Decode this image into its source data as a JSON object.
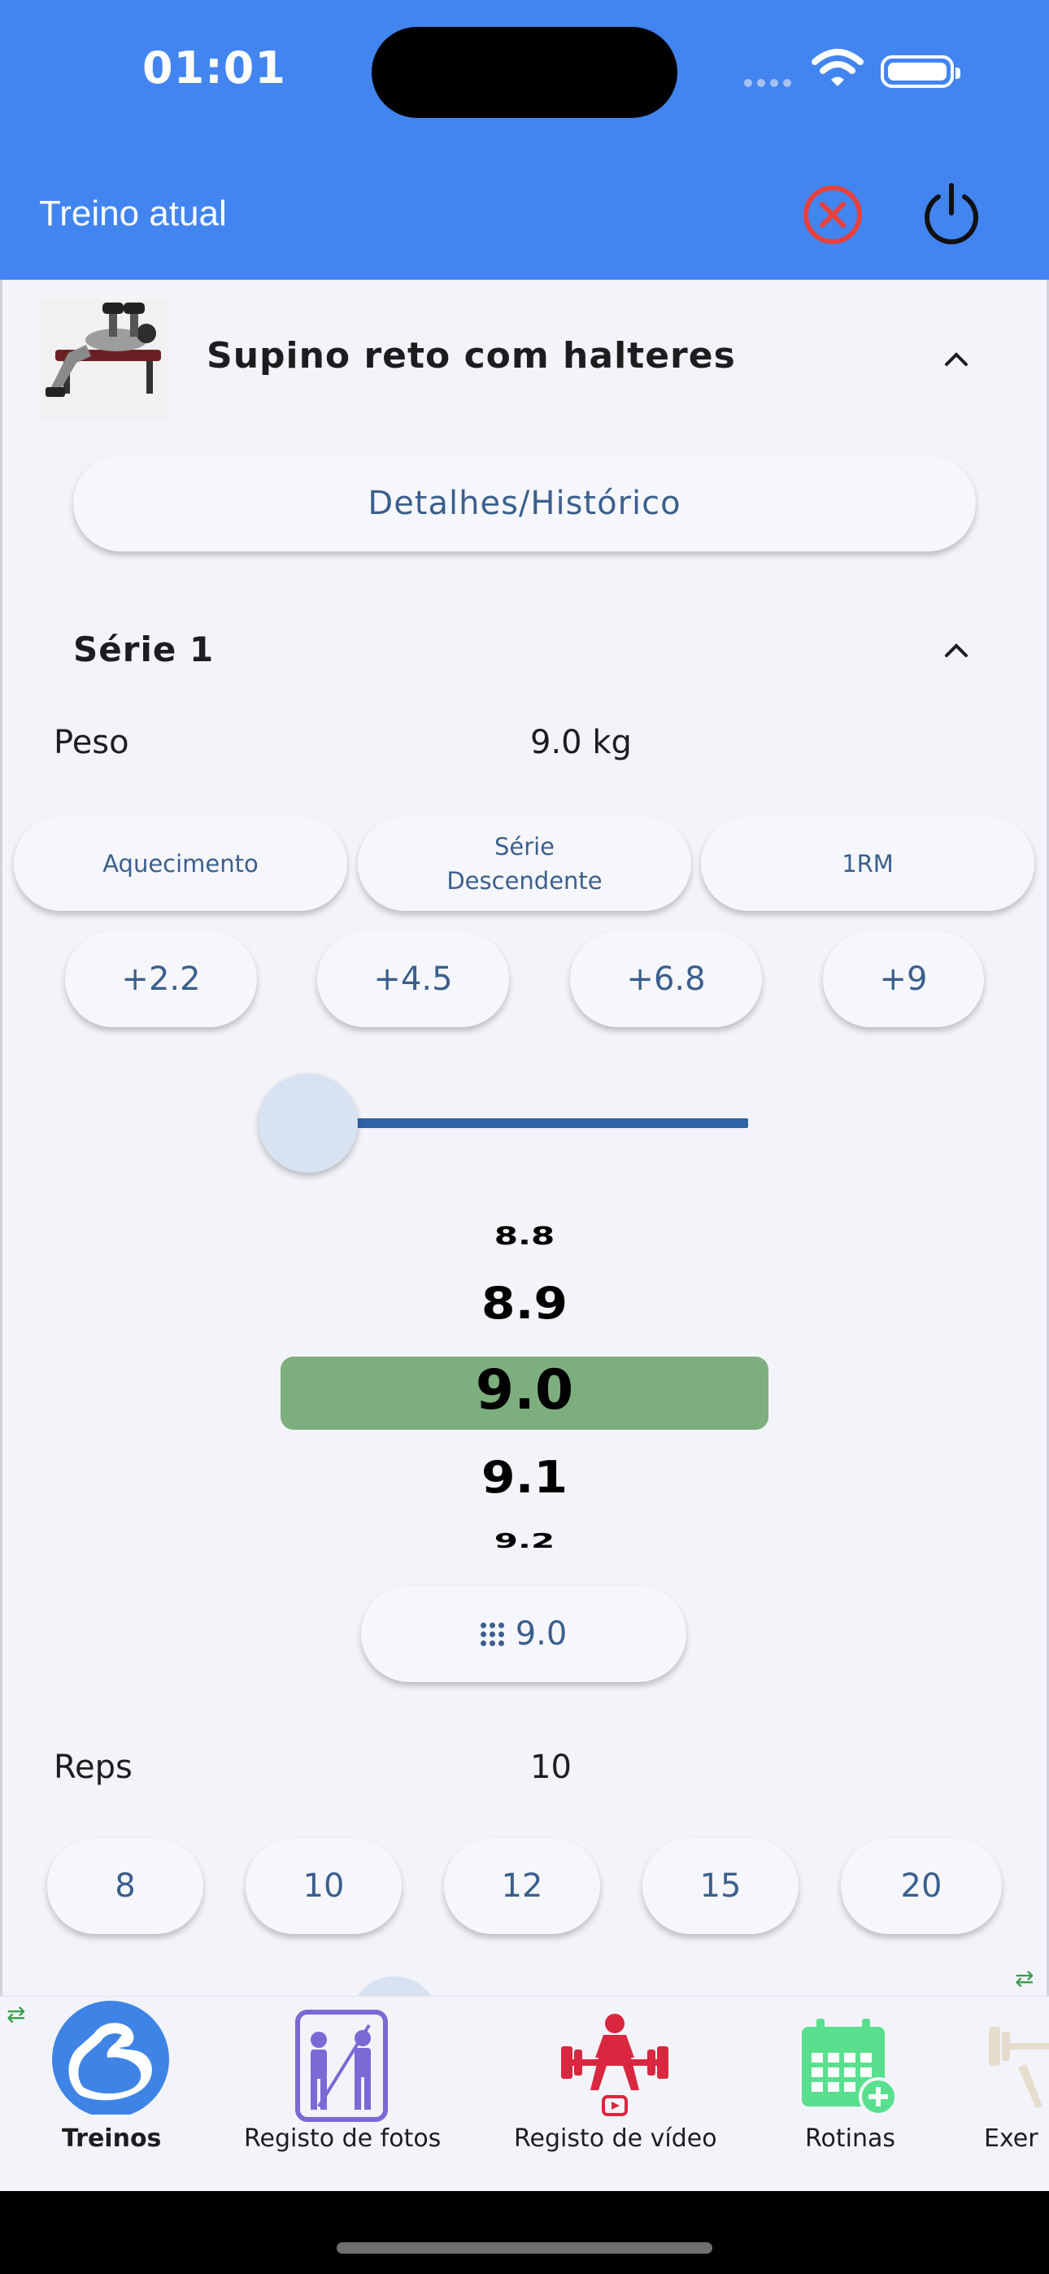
{
  "status_bar": {
    "time": "01:01"
  },
  "app_bar": {
    "title": "Treino atual"
  },
  "exercise": {
    "name": "Supino reto com halteres",
    "details_label": "Detalhes/Histórico"
  },
  "set": {
    "title": "Série 1",
    "weight_label": "Peso",
    "weight_value": "9.0 kg",
    "type_buttons": [
      "Aquecimento",
      "Série Descendente",
      "1RM"
    ],
    "type_button_lines": {
      "drop_line1": "Série",
      "drop_line2": "Descendente"
    },
    "increments": [
      "+2.2",
      "+4.5",
      "+6.8",
      "+9"
    ],
    "slider_level": 0.0,
    "picker_values": [
      "8.8",
      "8.9",
      "9.0",
      "9.1",
      "9.2"
    ],
    "picker_selected": "9.0",
    "keypad_value": "9.0",
    "reps_label": "Reps",
    "reps_value": "10",
    "reps_options": [
      "8",
      "10",
      "12",
      "15",
      "20"
    ]
  },
  "bottom_nav": {
    "items": [
      {
        "label": "Treinos",
        "icon": "biceps-icon",
        "active": true
      },
      {
        "label": "Registo de fotos",
        "icon": "photo-log-icon"
      },
      {
        "label": "Registo de vídeo",
        "icon": "weightlifter-video-icon"
      },
      {
        "label": "Rotinas",
        "icon": "calendar-icon"
      },
      {
        "label": "Exer",
        "icon": "dumbbell-icon"
      }
    ]
  },
  "colors": {
    "app_bar": "#4285f0",
    "cancel_red": "#e8403a",
    "picker_selected": "#7daf7e",
    "accent_text": "#3b5f8d",
    "slider": "#2f64a8"
  }
}
